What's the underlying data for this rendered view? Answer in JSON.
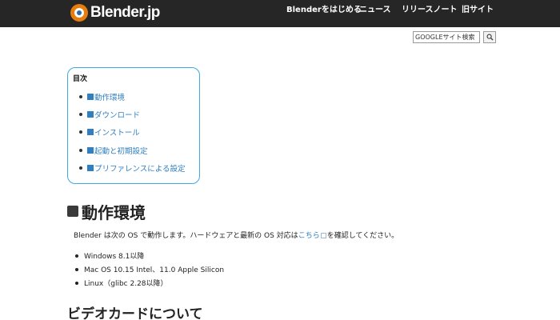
{
  "header": {
    "logo_text": "Blender.jp",
    "nav": [
      "Blenderをはじめる",
      "ニュース",
      "リリースノート",
      "旧サイト"
    ]
  },
  "search": {
    "placeholder": "GOOGLEサイト検索"
  },
  "toc": {
    "title": "目次",
    "items": [
      "動作環境",
      "ダウンロード",
      "インストール",
      "起動と初期設定",
      "プリファレンスによる設定"
    ]
  },
  "main": {
    "heading": "動作環境",
    "para_before": "Blender は次の OS で動作します。ハードウェアと最新の OS 対応は",
    "para_link": "こちら",
    "para_after": "を確認してください。",
    "bullets": [
      "Windows 8.1以降",
      "Mac OS 10.15 Intel、11.0 Apple Silicon",
      "Linux（glibc 2.28以降）"
    ],
    "subheading": "ビデオカードについて"
  },
  "colors": {
    "header_bg": "#262626",
    "link": "#2f7fc1",
    "toc_border": "#42a8e0",
    "logo_orange": "#e87d0d"
  },
  "icons": [
    "blender-logo-icon",
    "search-icon",
    "external-link-icon"
  ]
}
